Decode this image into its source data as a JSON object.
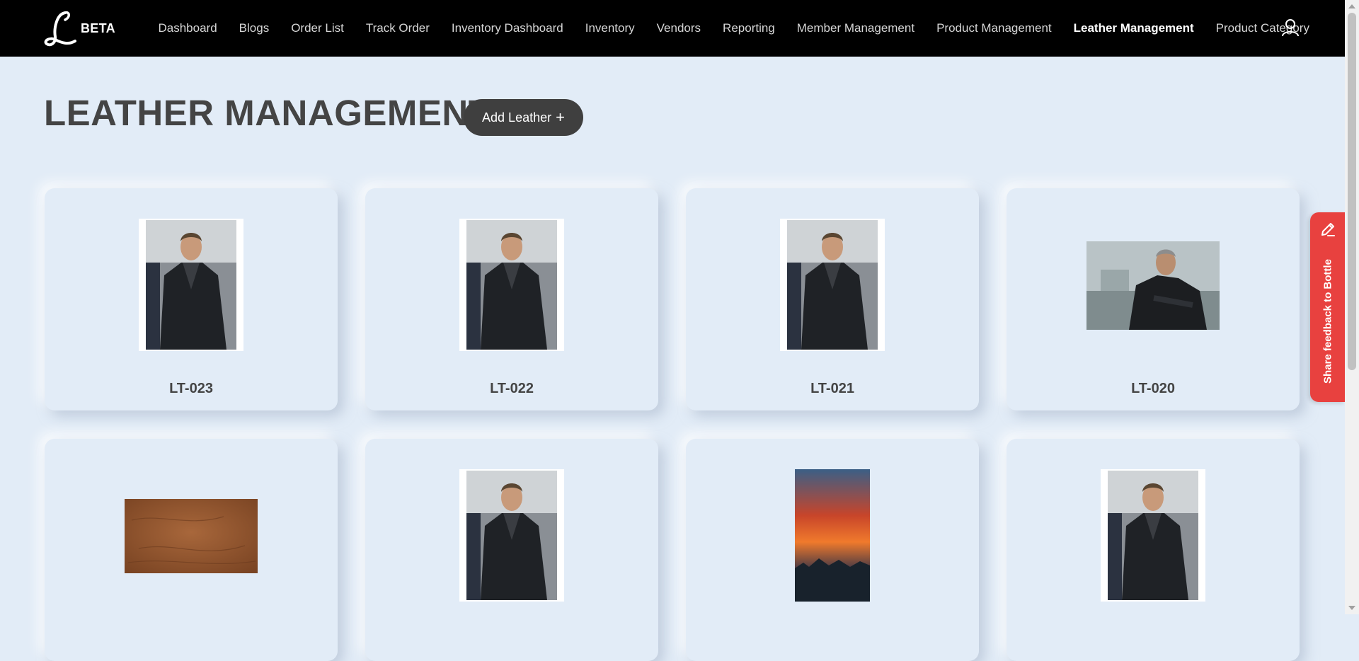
{
  "brand": {
    "badge": "BETA",
    "logo_icon": "script-l-logo"
  },
  "nav": {
    "items": [
      {
        "label": "Dashboard",
        "active": false
      },
      {
        "label": "Blogs",
        "active": false
      },
      {
        "label": "Order List",
        "active": false
      },
      {
        "label": "Track Order",
        "active": false
      },
      {
        "label": "Inventory Dashboard",
        "active": false
      },
      {
        "label": "Inventory",
        "active": false
      },
      {
        "label": "Vendors",
        "active": false
      },
      {
        "label": "Reporting",
        "active": false
      },
      {
        "label": "Member Management",
        "active": false
      },
      {
        "label": "Product Management",
        "active": false
      },
      {
        "label": "Leather Management",
        "active": true
      },
      {
        "label": "Product Category",
        "active": false
      }
    ],
    "user_icon": "user-icon"
  },
  "page": {
    "title": "LEATHER MANAGEMENT",
    "add_button_label": "Add Leather",
    "add_button_icon": "plus-icon"
  },
  "leathers": [
    {
      "code": "LT-023",
      "image": "man-in-leather-jacket"
    },
    {
      "code": "LT-022",
      "image": "man-in-leather-jacket"
    },
    {
      "code": "LT-021",
      "image": "man-in-leather-jacket"
    },
    {
      "code": "LT-020",
      "image": "man-in-black-jacket-outdoors"
    },
    {
      "code": "",
      "image": "brown-leather-texture"
    },
    {
      "code": "",
      "image": "man-in-leather-jacket"
    },
    {
      "code": "",
      "image": "sunset-sky"
    },
    {
      "code": "",
      "image": "man-in-leather-jacket"
    }
  ],
  "feedback": {
    "label": "Share feedback to Bottle",
    "icon": "pencil-icon",
    "color": "#e8413f"
  },
  "colors": {
    "background": "#e2ecf7",
    "topbar": "#000000",
    "button": "#3f3f3f"
  }
}
